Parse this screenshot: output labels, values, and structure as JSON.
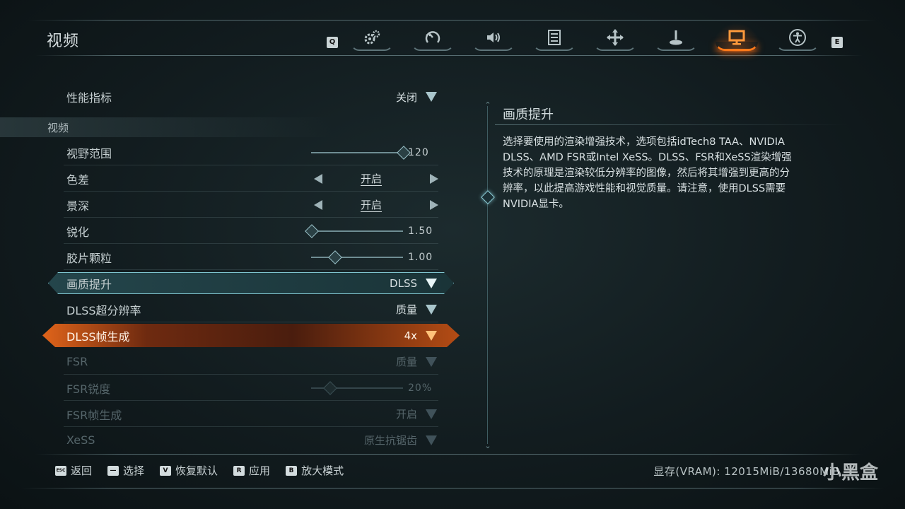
{
  "header": {
    "title": "视频",
    "key_prev": "Q",
    "key_next": "E",
    "tabs": [
      {
        "icon": "gears-icon",
        "active": false
      },
      {
        "icon": "dial-icon",
        "active": false
      },
      {
        "icon": "speaker-icon",
        "active": false
      },
      {
        "icon": "list-icon",
        "active": false
      },
      {
        "icon": "move-icon",
        "active": false
      },
      {
        "icon": "joystick-icon",
        "active": false
      },
      {
        "icon": "monitor-icon",
        "active": true
      },
      {
        "icon": "accessibility-icon",
        "active": false
      }
    ]
  },
  "list": {
    "cut_top_label": "性能指标",
    "cut_top_value": "关闭",
    "section_title": "视频",
    "fov_label": "视野范围",
    "fov_value": "120",
    "fov_level": 1.0,
    "chroma_label": "色差",
    "chroma_value": "开启",
    "dof_label": "景深",
    "dof_value": "开启",
    "sharpen_label": "锐化",
    "sharpen_value": "1.50",
    "sharpen_level": 0.0,
    "grain_label": "胶片颗粒",
    "grain_value": "1.00",
    "grain_level": 0.25,
    "upscale_label": "画质提升",
    "upscale_value": "DLSS",
    "dlss_sr_label": "DLSS超分辨率",
    "dlss_sr_value": "质量",
    "dlss_fg_label": "DLSS帧生成",
    "dlss_fg_value": "4x",
    "fsr_label": "FSR",
    "fsr_value": "质量",
    "fsr_sharp_label": "FSR锐度",
    "fsr_sharp_value": "20%",
    "fsr_sharp_level": 0.2,
    "fsr_fg_label": "FSR帧生成",
    "fsr_fg_value": "开启",
    "cut_bottom_label": "XeSS",
    "cut_bottom_value": "原生抗锯齿"
  },
  "description": {
    "title": "画质提升",
    "text": "选择要使用的渲染增强技术，选项包括idTech8 TAA、NVIDIA DLSS、AMD FSR或Intel XeSS。DLSS、FSR和XeSS渲染增强技术的原理是渲染较低分辨率的图像，然后将其增强到更高的分辨率，以此提高游戏性能和视觉质量。请注意，使用DLSS需要NVIDIA显卡。"
  },
  "footer": {
    "back_key": "ESC",
    "back_label": "返回",
    "select_key": "—",
    "select_label": "选择",
    "reset_key": "V",
    "reset_label": "恢复默认",
    "apply_key": "R",
    "apply_label": "应用",
    "zoom_key": "B",
    "zoom_label": "放大模式",
    "vram": "显存(VRAM): 12015MiB/13680MiB"
  },
  "watermark": "小黑盒",
  "colors": {
    "accent_orange": "#ff7a1a",
    "accent_cyan": "#7fc5cf"
  }
}
